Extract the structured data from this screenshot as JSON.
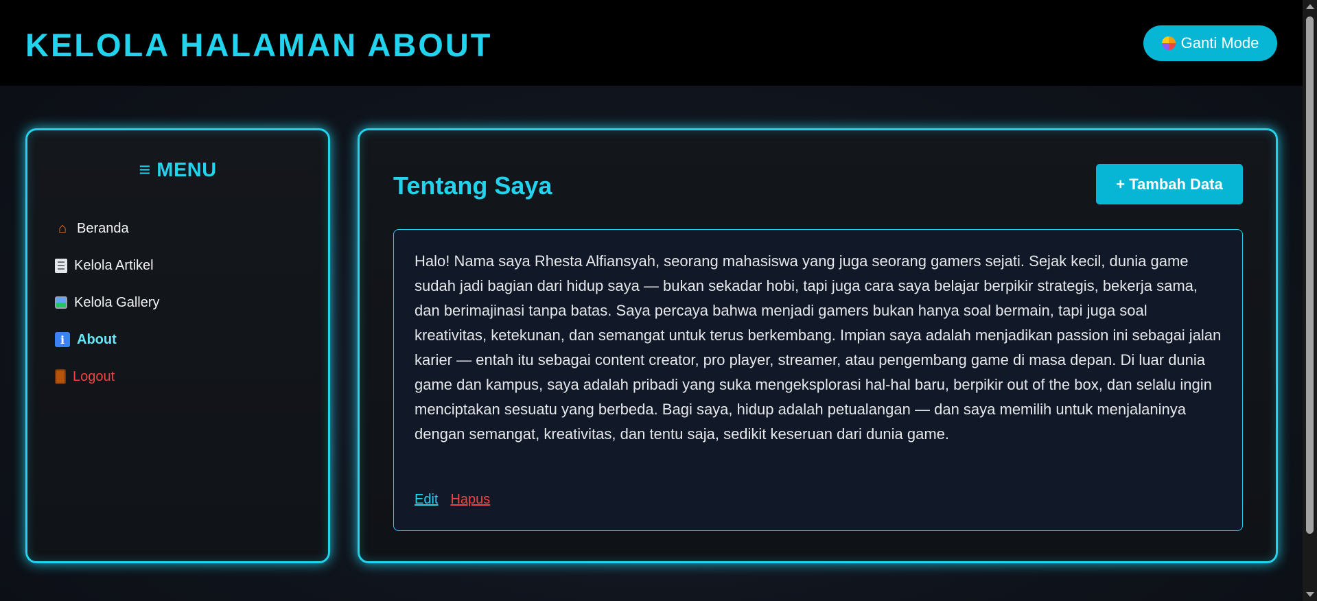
{
  "header": {
    "title": "KELOLA HALAMAN ABOUT",
    "mode_button_label": "Ganti Mode",
    "mode_button_icon": "palette-icon"
  },
  "sidebar": {
    "menu_title": "≡ MENU",
    "items": [
      {
        "label": "Beranda",
        "icon": "house-icon",
        "state": "normal"
      },
      {
        "label": "Kelola Artikel",
        "icon": "memo-icon",
        "state": "normal"
      },
      {
        "label": "Kelola Gallery",
        "icon": "framed-picture-icon",
        "state": "normal"
      },
      {
        "label": "About",
        "icon": "info-icon",
        "state": "active"
      },
      {
        "label": "Logout",
        "icon": "door-icon",
        "state": "danger"
      }
    ]
  },
  "main": {
    "section_title": "Tentang Saya",
    "add_button_label": "+ Tambah Data",
    "about_card": {
      "text": "Halo! Nama saya Rhesta Alfiansyah, seorang mahasiswa yang juga seorang gamers sejati. Sejak kecil, dunia game sudah jadi bagian dari hidup saya — bukan sekadar hobi, tapi juga cara saya belajar berpikir strategis, bekerja sama, dan berimajinasi tanpa batas. Saya percaya bahwa menjadi gamers bukan hanya soal bermain, tapi juga soal kreativitas, ketekunan, dan semangat untuk terus berkembang. Impian saya adalah menjadikan passion ini sebagai jalan karier — entah itu sebagai content creator, pro player, streamer, atau pengembang game di masa depan. Di luar dunia game dan kampus, saya adalah pribadi yang suka mengeksplorasi hal-hal baru, berpikir out of the box, dan selalu ingin menciptakan sesuatu yang berbeda. Bagi saya, hidup adalah petualangan — dan saya memilih untuk menjalaninya dengan semangat, kreativitas, dan tentu saja, sedikit keseruan dari dunia game.",
      "edit_label": "Edit",
      "delete_label": "Hapus"
    }
  },
  "colors": {
    "accent": "#22d3ee",
    "button": "#06b6d4",
    "danger": "#ef4444",
    "background": "#0d1117"
  }
}
